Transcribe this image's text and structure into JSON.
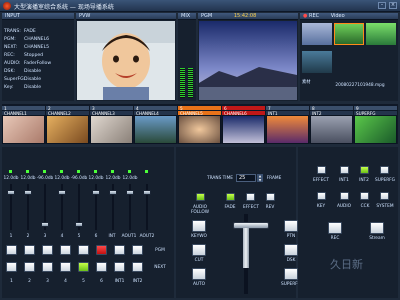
{
  "app": {
    "title": "大型演播室综合系统 — 现场导播系统"
  },
  "window": {
    "minimize": "–",
    "close": "×"
  },
  "panels": {
    "input": "INPUT",
    "pvw": "PVW",
    "mix": "MIX",
    "pgm": "PGM",
    "video": "Video",
    "rec": "REC"
  },
  "pgm_timecode": "15:42:08",
  "status": [
    {
      "k": "TRANS:",
      "v": "FADE"
    },
    {
      "k": "PGM:",
      "v": "CHANNEL6"
    },
    {
      "k": "NEXT:",
      "v": "CHANNEL5"
    },
    {
      "k": "REC:",
      "v": "Stopped"
    },
    {
      "k": "AUDIO:",
      "v": "FaderFollow"
    },
    {
      "k": "DSK:",
      "v": "Disable"
    },
    {
      "k": "SuperFG:",
      "v": "Disable"
    },
    {
      "k": "Key:",
      "v": "Disable"
    }
  ],
  "video_panel": {
    "label": "素材",
    "filename": "20080227101948.mpg"
  },
  "channels": [
    {
      "num": "1",
      "name": "CHANNEL1"
    },
    {
      "num": "2",
      "name": "CHANNEL2"
    },
    {
      "num": "3",
      "name": "CHANNEL3"
    },
    {
      "num": "4",
      "name": "CHANNEL4"
    },
    {
      "num": "5",
      "name": "CHANNEL5"
    },
    {
      "num": "6",
      "name": "CHANNEL6"
    },
    {
      "num": "7",
      "name": "INT1"
    },
    {
      "num": "8",
      "name": "INT2"
    },
    {
      "num": "9",
      "name": "SUPERFG"
    }
  ],
  "fader_db": [
    "12.0db",
    "12.0db",
    "-96.0db",
    "12.0db",
    "-96.0db",
    "12.0db",
    "12.0db",
    "12.0db"
  ],
  "fader_labels": [
    "1",
    "2",
    "3",
    "4",
    "5",
    "6",
    "INT",
    "AOUT1",
    "AOUT2"
  ],
  "pgm_row_label": "PGM",
  "next_row_label": "NEXT",
  "bottom_labels": [
    "1",
    "2",
    "3",
    "4",
    "5",
    "6",
    "INT1",
    "INT2"
  ],
  "trans": {
    "time_label": "TRANS TIME",
    "frame_label": "FRAME",
    "time_value": "25"
  },
  "effect_row": [
    "AUDIO FOLLOW",
    "FADE",
    "EFFECT",
    "REV"
  ],
  "right_top": [
    "EFFECT",
    "INT1",
    "INT2",
    "SUPERFG"
  ],
  "right_mid": [
    "KEY",
    "AUDIO",
    "CCK",
    "SYSTEM"
  ],
  "left_btns": [
    "KEYWO",
    "CUT",
    "AUTO"
  ],
  "mid_btns": [
    "PTN",
    "DSK",
    "SUPERFG"
  ],
  "rec_btns": [
    "REC",
    "Stream"
  ],
  "watermark": "久日新"
}
